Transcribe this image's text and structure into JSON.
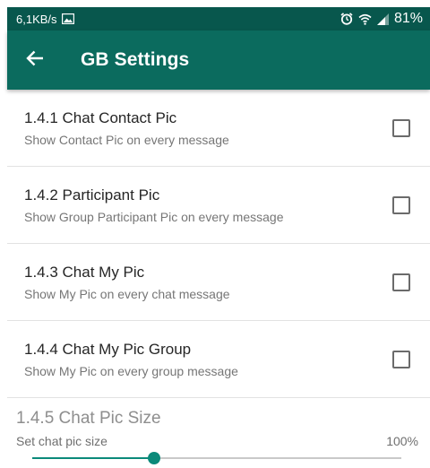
{
  "status_bar": {
    "speed": "6,1KB/s",
    "battery": "81%",
    "icons": [
      "image-icon",
      "alarm-icon",
      "wifi-icon",
      "signal-icon"
    ]
  },
  "app_bar": {
    "title": "GB Settings",
    "back_icon": "arrow-left-icon",
    "color": "#0b6b5e"
  },
  "items": [
    {
      "title": "1.4.1 Chat Contact Pic",
      "subtitle": "Show Contact Pic on every message",
      "checked": false
    },
    {
      "title": "1.4.2 Participant Pic",
      "subtitle": "Show Group Participant Pic on every message",
      "checked": false
    },
    {
      "title": "1.4.3 Chat My Pic",
      "subtitle": "Show My Pic on every chat message",
      "checked": false
    },
    {
      "title": "1.4.4 Chat My Pic Group",
      "subtitle": "Show My Pic on every group message",
      "checked": false
    }
  ],
  "slider": {
    "title": "1.4.5 Chat Pic Size",
    "subtitle": "Set chat pic size",
    "value_label": "100%",
    "position_fraction": 0.33,
    "accent": "#0b8a7a"
  }
}
